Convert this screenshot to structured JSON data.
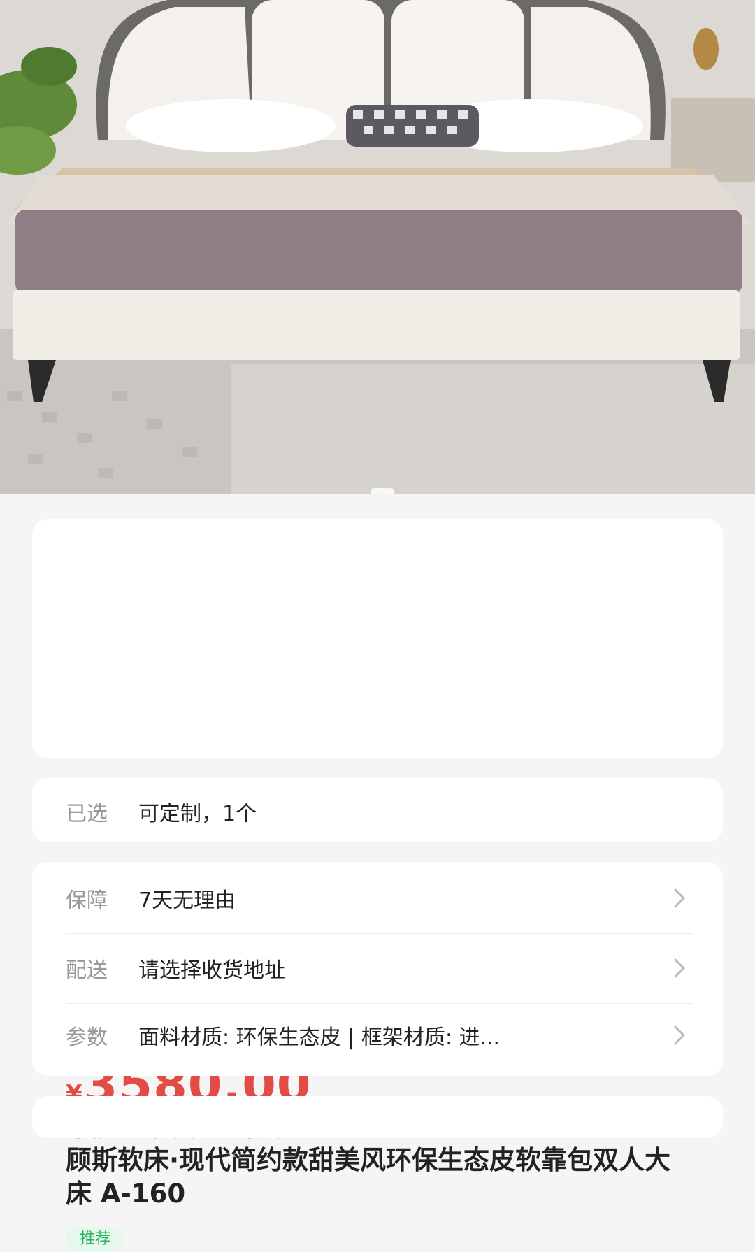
{
  "product": {
    "currency": "¥",
    "price": "3580.00",
    "stats": {
      "monthly_sales": "月销 0",
      "rating": "好评率 --",
      "favorites": "收藏 0"
    },
    "title": "顾斯软床·现代简约款甜美风环保生态皮软靠包双人大床 A-160",
    "tag": "推荐"
  },
  "selection": {
    "label": "已选",
    "value": "可定制，1个"
  },
  "info_rows": [
    {
      "label": "保障",
      "value": "7天无理由"
    },
    {
      "label": "配送",
      "value": "请选择收货地址"
    },
    {
      "label": "参数",
      "value": "面料材质: 环保生态皮 | 框架材质: 进..."
    }
  ],
  "icons": {
    "chevron": "chevron-right-icon"
  },
  "colors": {
    "price": "#e34b45",
    "tag_text": "#27b061",
    "tag_bg": "#e6f7ec"
  }
}
